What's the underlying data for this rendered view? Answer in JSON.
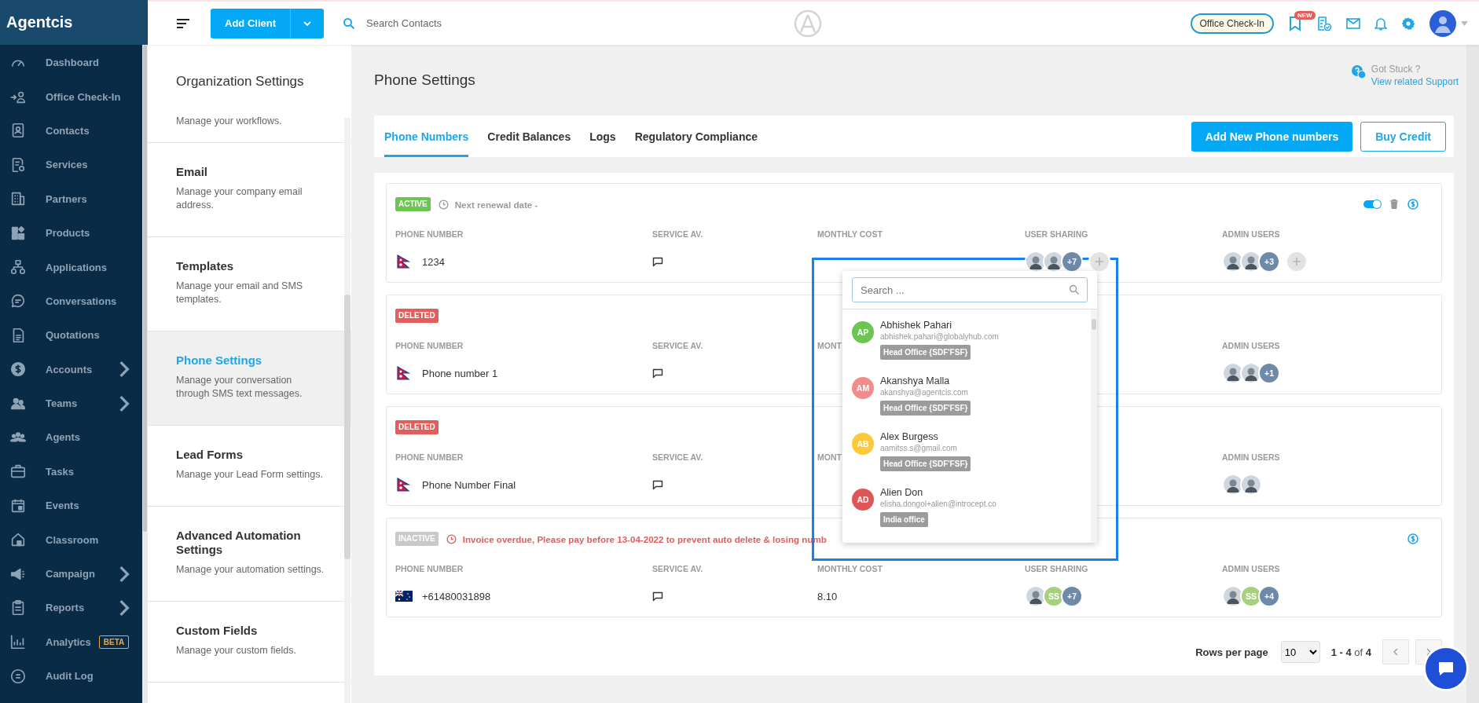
{
  "sidebar": {
    "logo": "Agentcis",
    "items": [
      {
        "label": "Dashboard",
        "expandable": false
      },
      {
        "label": "Office Check-In",
        "expandable": false
      },
      {
        "label": "Contacts",
        "expandable": false
      },
      {
        "label": "Services",
        "expandable": false
      },
      {
        "label": "Partners",
        "expandable": false
      },
      {
        "label": "Products",
        "expandable": false
      },
      {
        "label": "Applications",
        "expandable": false
      },
      {
        "label": "Conversations",
        "expandable": false
      },
      {
        "label": "Quotations",
        "expandable": false
      },
      {
        "label": "Accounts",
        "expandable": true
      },
      {
        "label": "Teams",
        "expandable": true
      },
      {
        "label": "Agents",
        "expandable": false
      },
      {
        "label": "Tasks",
        "expandable": false
      },
      {
        "label": "Events",
        "expandable": false
      },
      {
        "label": "Classroom",
        "expandable": false
      },
      {
        "label": "Campaign",
        "expandable": true
      },
      {
        "label": "Reports",
        "expandable": true
      },
      {
        "label": "Analytics",
        "expandable": false,
        "badge": "BETA"
      },
      {
        "label": "Audit Log",
        "expandable": false
      }
    ]
  },
  "topbar": {
    "add_client": "Add Client",
    "search": {
      "placeholder": "Search Contacts"
    },
    "check_in": "Office Check-In",
    "new_badge": "NEW"
  },
  "settings_panel": {
    "title": "Organization Settings",
    "items": [
      {
        "description": "Manage your workflows.",
        "selected": false
      },
      {
        "title": "Email",
        "description": "Manage your company email address.",
        "selected": false
      },
      {
        "title": "Templates",
        "description": "Manage your email and SMS templates.",
        "selected": false
      },
      {
        "title": "Phone Settings",
        "description": "Manage your conversation through SMS text messages.",
        "selected": true
      },
      {
        "title": "Lead Forms",
        "description": "Manage your Lead Form settings.",
        "selected": false
      },
      {
        "title": "Advanced Automation Settings",
        "description": "Manage your automation settings.",
        "selected": false
      },
      {
        "title": "Custom Fields",
        "description": "Manage your custom fields.",
        "selected": false
      }
    ]
  },
  "page": {
    "title": "Phone Settings",
    "help": {
      "title": "Got Stuck ?",
      "link": "View related Support"
    },
    "tabs": [
      {
        "label": "Phone Numbers",
        "selected": true
      },
      {
        "label": "Credit Balances",
        "selected": false
      },
      {
        "label": "Logs",
        "selected": false
      },
      {
        "label": "Regulatory Compliance",
        "selected": false
      }
    ],
    "buttons": {
      "primary": "Add New Phone numbers",
      "secondary": "Buy Credit"
    },
    "cards": [
      {
        "status": {
          "kind": "active",
          "label": "ACTIVE"
        },
        "notice": {
          "kind": "renewal",
          "text": "Next renewal date -"
        },
        "actions": [
          {
            "kind": "toggle",
            "on": true
          },
          {
            "kind": "delete"
          },
          {
            "kind": "billing"
          }
        ],
        "columns": [
          {
            "kind": "phone",
            "heading": "PHONE NUMBER",
            "flag": {
              "kind": "nepal"
            },
            "value": "1234"
          },
          {
            "kind": "service",
            "heading": "SERVICE AV."
          },
          {
            "kind": "cost",
            "heading": "MONTHLY COST"
          },
          {
            "kind": "sharing",
            "heading": "USER SHARING",
            "avatars": [
              {
                "kind": "photo"
              },
              {
                "kind": "photo"
              },
              {
                "kind": "count",
                "text": "+7"
              },
              {
                "kind": "add"
              }
            ]
          },
          {
            "kind": "admin",
            "heading": "ADMIN USERS",
            "avatars": [
              {
                "kind": "photo"
              },
              {
                "kind": "photo"
              },
              {
                "kind": "count",
                "text": "+3"
              },
              {
                "kind": "add"
              }
            ]
          }
        ]
      },
      {
        "status": {
          "kind": "deleted",
          "label": "DELETED"
        },
        "columns": [
          {
            "kind": "phone",
            "heading": "PHONE NUMBER",
            "flag": {
              "kind": "nepal"
            },
            "value": "Phone number 1"
          },
          {
            "kind": "service",
            "heading": "SERVICE AV."
          },
          {
            "kind": "cost",
            "heading": "MONT"
          },
          {
            "kind": "admin",
            "heading": "ADMIN USERS",
            "avatars": [
              {
                "kind": "photo"
              },
              {
                "kind": "photo"
              },
              {
                "kind": "count",
                "text": "+1"
              }
            ]
          }
        ]
      },
      {
        "status": {
          "kind": "deleted",
          "label": "DELETED"
        },
        "columns": [
          {
            "kind": "phone",
            "heading": "PHONE NUMBER",
            "flag": {
              "kind": "nepal"
            },
            "value": "Phone Number Final"
          },
          {
            "kind": "service",
            "heading": "SERVICE AV."
          },
          {
            "kind": "cost",
            "heading": "MONT"
          },
          {
            "kind": "admin",
            "heading": "ADMIN USERS",
            "avatars": [
              {
                "kind": "photo"
              },
              {
                "kind": "photo"
              }
            ]
          }
        ]
      },
      {
        "status": {
          "kind": "inactive",
          "label": "INACTIVE"
        },
        "notice": {
          "kind": "overdue",
          "text": "Invoice overdue, Please pay before 13-04-2022 to prevent auto delete & losing numb"
        },
        "actions": [
          {
            "kind": "billing"
          }
        ],
        "columns": [
          {
            "kind": "phone",
            "heading": "PHONE NUMBER",
            "flag": {
              "kind": "australia"
            },
            "value": "+61480031898"
          },
          {
            "kind": "service",
            "heading": "SERVICE AV."
          },
          {
            "kind": "cost",
            "heading": "MONTHLY COST",
            "value": "8.10"
          },
          {
            "kind": "sharing",
            "heading": "USER SHARING",
            "avatars": [
              {
                "kind": "photo"
              },
              {
                "kind": "initials",
                "text": "SS"
              },
              {
                "kind": "count",
                "text": "+7"
              }
            ]
          },
          {
            "kind": "admin",
            "heading": "ADMIN USERS",
            "avatars": [
              {
                "kind": "photo"
              },
              {
                "kind": "initials",
                "text": "SS"
              },
              {
                "kind": "count",
                "text": "+4"
              }
            ]
          }
        ]
      }
    ],
    "pagination": {
      "label": "Rows per page",
      "rows": "10",
      "range": "**1 - 4** of **4**"
    },
    "user_picker": {
      "search": {
        "placeholder": "Search ..."
      },
      "users": [
        {
          "initials": "AP",
          "name": "Abhishek Pahari",
          "email": "abhishek.pahari@globalyhub.com",
          "office": "Head Office {SDF'FSF}",
          "color": "#6cc551"
        },
        {
          "initials": "AM",
          "name": "Akanshya Malla",
          "email": "akanshya@agentcis.com",
          "office": "Head Office {SDF'FSF}",
          "color": "#f28b8b"
        },
        {
          "initials": "AB",
          "name": "Alex Burgess",
          "email": "aamitss.s@gmail.com",
          "office": "Head Office {SDF'FSF}",
          "color": "#fdc93a"
        },
        {
          "initials": "AD",
          "name": "Alien Don",
          "email": "elisha.dongol+alien@introcept.co",
          "office": "India office",
          "color": "#e05656"
        }
      ]
    }
  }
}
